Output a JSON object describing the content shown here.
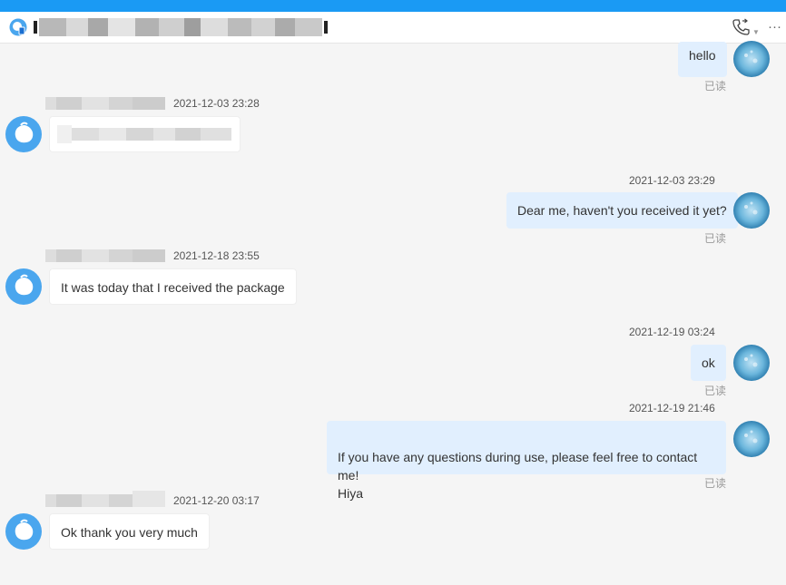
{
  "header": {
    "title": "",
    "call_icon": "phone-icon",
    "dropdown_icon": "chevron-down-icon",
    "more_icon": "more-icon",
    "more_label": "···"
  },
  "colors": {
    "accent": "#1a9af4",
    "self_bubble": "#e1effe",
    "other_bubble": "#ffffff",
    "background": "#f5f5f5"
  },
  "messages": [
    {
      "sender": "self",
      "time": "",
      "text": "hello",
      "status": "已读"
    },
    {
      "sender": "other",
      "time": "2021-12-03 23:28",
      "text": ""
    },
    {
      "sender": "self",
      "time": "2021-12-03 23:29",
      "text": "Dear me, haven't you received it yet?",
      "status": "已读"
    },
    {
      "sender": "other",
      "time": "2021-12-18 23:55",
      "text": "It was today that I received the package"
    },
    {
      "sender": "self",
      "time": "2021-12-19 03:24",
      "text": "ok",
      "status": "已读"
    },
    {
      "sender": "self",
      "time": "2021-12-19 21:46",
      "text": "If you have any questions during use, please feel free to contact me!\nHiya",
      "status": "已读"
    },
    {
      "sender": "other",
      "time": "2021-12-20 03:17",
      "text": "Ok thank you very much"
    }
  ]
}
